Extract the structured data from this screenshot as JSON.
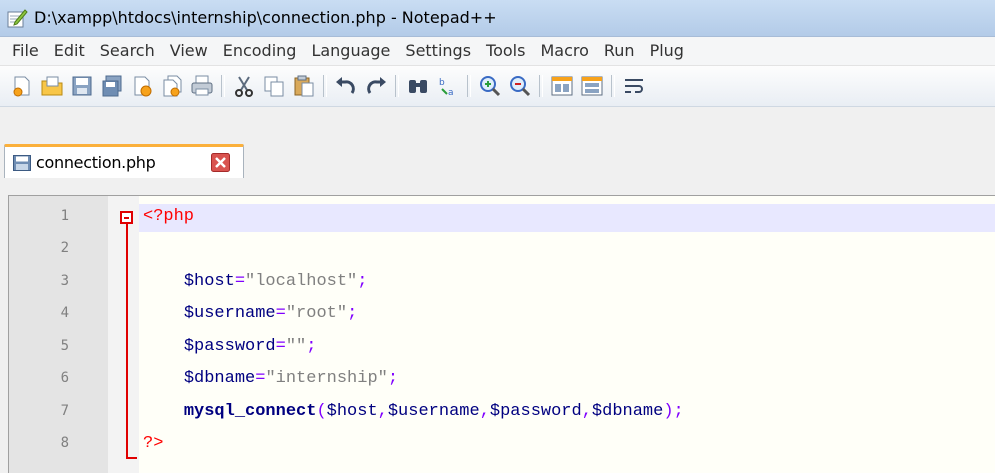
{
  "window": {
    "title": "D:\\xampp\\htdocs\\internship\\connection.php - Notepad++",
    "icon": "notepad-pencil-icon"
  },
  "menu": [
    "File",
    "Edit",
    "Search",
    "View",
    "Encoding",
    "Language",
    "Settings",
    "Tools",
    "Macro",
    "Run",
    "Plug"
  ],
  "toolbar": {
    "buttons": [
      {
        "name": "new-file-icon"
      },
      {
        "name": "open-file-icon"
      },
      {
        "name": "save-icon"
      },
      {
        "name": "save-all-icon"
      },
      {
        "name": "close-icon"
      },
      {
        "name": "close-all-icon"
      },
      {
        "name": "print-icon"
      },
      {
        "name": "cut-icon"
      },
      {
        "name": "copy-icon"
      },
      {
        "name": "paste-icon"
      },
      {
        "name": "undo-icon"
      },
      {
        "name": "redo-icon"
      },
      {
        "name": "find-icon"
      },
      {
        "name": "replace-icon"
      },
      {
        "name": "zoom-in-icon"
      },
      {
        "name": "zoom-out-icon"
      },
      {
        "name": "sync-vertical-icon"
      },
      {
        "name": "sync-horizontal-icon"
      },
      {
        "name": "word-wrap-icon"
      }
    ]
  },
  "tabs": [
    {
      "label": "connection.php",
      "icon": "save-state-icon",
      "close_icon": "tab-close-icon",
      "active": true
    }
  ],
  "editor": {
    "current_line": 1,
    "lines": [
      {
        "num": "1",
        "text": "<?php"
      },
      {
        "num": "2",
        "text": ""
      },
      {
        "num": "3",
        "text": "    $host=\"localhost\";"
      },
      {
        "num": "4",
        "text": "    $username=\"root\";"
      },
      {
        "num": "5",
        "text": "    $password=\"\";"
      },
      {
        "num": "6",
        "text": "    $dbname=\"internship\";"
      },
      {
        "num": "7",
        "text": "    mysql_connect($host,$username,$password,$dbname);"
      },
      {
        "num": "8",
        "text": "?>"
      }
    ]
  },
  "colors": {
    "php_tag": "#ff0000",
    "variable": "#000080",
    "operator": "#8000ff",
    "string": "#808080",
    "function": "#000080",
    "fold_marker": "#e00000",
    "active_tab_accent": "#fbb03b",
    "current_line": "#e8e8ff"
  }
}
